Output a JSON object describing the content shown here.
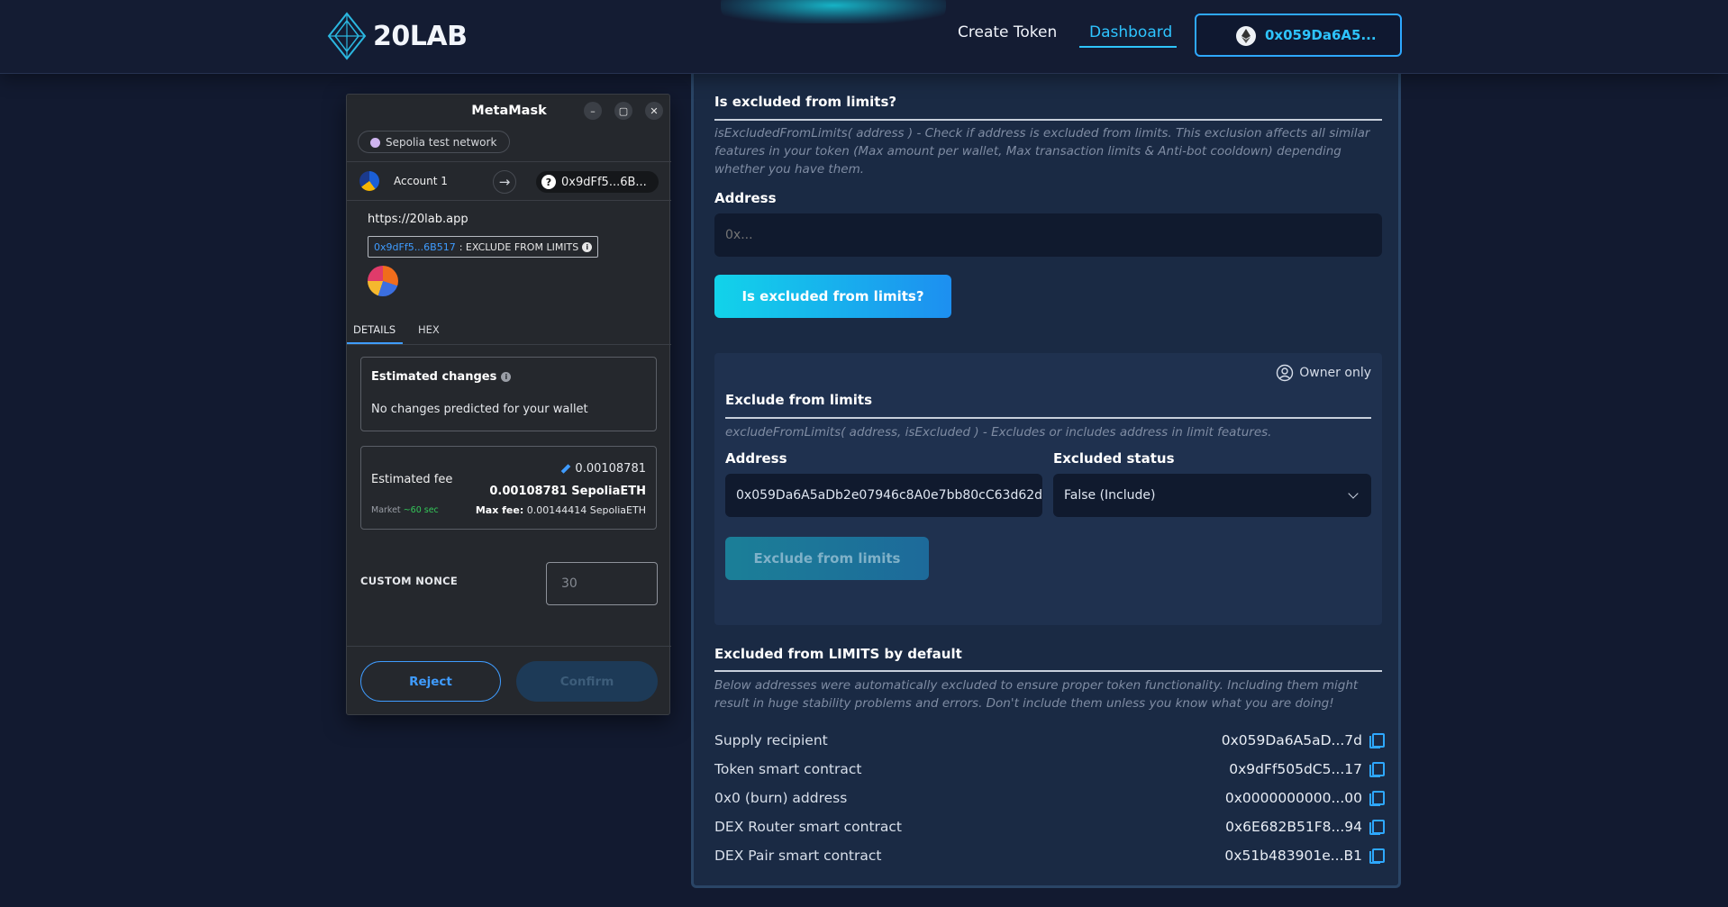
{
  "header": {
    "logo_text": "20LAB",
    "nav": {
      "create_token": "Create Token",
      "dashboard": "Dashboard"
    },
    "wallet_address": "0x059Da6A5..."
  },
  "check_section": {
    "title": "Is excluded from limits?",
    "description": "isExcludedFromLimits( address ) - Check if address is excluded from limits. This exclusion affects all similar features in your token (Max amount per wallet, Max transaction limits & Anti-bot cooldown) depending whether you have them.",
    "address_label": "Address",
    "address_placeholder": "0x...",
    "button": "Is excluded from limits?"
  },
  "exclude_section": {
    "owner_badge": "Owner only",
    "title": "Exclude from limits",
    "description": "excludeFromLimits( address, isExcluded ) - Excludes or includes address in limit features.",
    "address_label": "Address",
    "address_value": "0x059Da6A5aDb2e07946c8A0e7bb80cC63d62d",
    "status_label": "Excluded status",
    "status_value": "False (Include)",
    "button": "Exclude from limits"
  },
  "defaults_section": {
    "title": "Excluded from LIMITS by default",
    "description": "Below addresses were automatically excluded to ensure proper token functionality. Including them might result in huge stability problems and errors. Don't include them unless you know what you are doing!",
    "rows": [
      {
        "label": "Supply recipient",
        "value": "0x059Da6A5aD...7d"
      },
      {
        "label": "Token smart contract",
        "value": "0x9dFf505dC5...17"
      },
      {
        "label": "0x0 (burn) address",
        "value": "0x0000000000...00"
      },
      {
        "label": "DEX Router smart contract",
        "value": "0x6E682B51F8...94"
      },
      {
        "label": "DEX Pair smart contract",
        "value": "0x51b483901e...B1"
      }
    ]
  },
  "metamask": {
    "title": "MetaMask",
    "network": "Sepolia test network",
    "account": "Account 1",
    "target_address": "0x9dFf5...6B...",
    "origin": "https://20lab.app",
    "method_address": "0x9dFf5...6B517",
    "method_name": ": EXCLUDE FROM LIMITS",
    "tabs": {
      "details": "DETAILS",
      "hex": "HEX"
    },
    "estimated_changes_title": "Estimated changes",
    "no_changes_text": "No changes predicted for your wallet",
    "estimated_fee_label": "Estimated fee",
    "fee_small": "0.00108781",
    "fee_big": "0.00108781 SepoliaETH",
    "market_label": "Market",
    "market_time": "~60 sec",
    "max_fee_label": "Max fee:",
    "max_fee_value": "0.00144414 SepoliaETH",
    "custom_nonce_label": "CUSTOM NONCE",
    "nonce_placeholder": "30",
    "reject": "Reject",
    "confirm": "Confirm"
  }
}
